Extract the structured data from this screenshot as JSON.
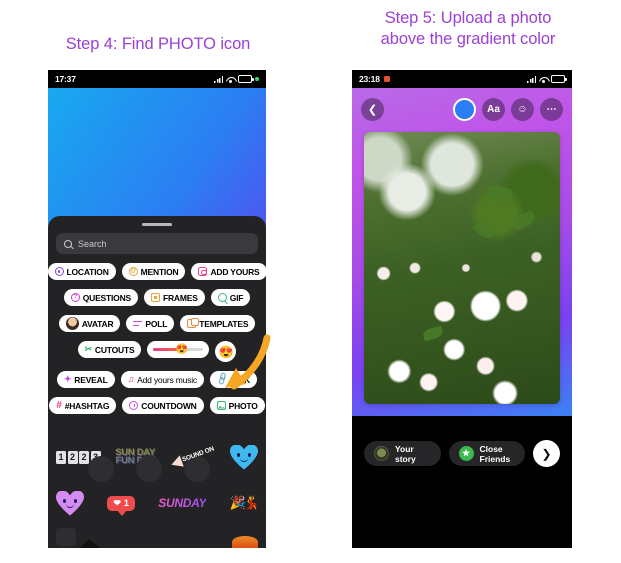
{
  "titles": {
    "left": "Step 4: Find PHOTO icon",
    "right_line1": "Step 5: Upload a photo",
    "right_line2": "above the gradient color"
  },
  "colors": {
    "title_purple": "#9b41d4",
    "arrow_orange": "#f5a623",
    "sheet_dark": "#232325",
    "accent_blue": "#2a7df5",
    "close_friends_green": "#3bb950"
  },
  "left_phone": {
    "status": {
      "time": "17:37",
      "signal": "signal-icon",
      "wifi": "wifi-icon",
      "battery": "60",
      "dot": "green-dot"
    },
    "search": {
      "placeholder": "Search",
      "icon": "search-icon"
    },
    "sticker_rows": [
      [
        {
          "label": "LOCATION",
          "icon": "location-pin-icon"
        },
        {
          "label": "MENTION",
          "icon": "at-mention-icon"
        },
        {
          "label": "ADD YOURS",
          "icon": "camera-icon"
        }
      ],
      [
        {
          "label": "QUESTIONS",
          "icon": "question-bubble-icon"
        },
        {
          "label": "FRAMES",
          "icon": "frame-icon"
        },
        {
          "label": "GIF",
          "icon": "gif-search-icon"
        }
      ],
      [
        {
          "label": "AVATAR",
          "icon": "avatar-icon"
        },
        {
          "label": "POLL",
          "icon": "poll-bars-icon"
        },
        {
          "label": "TEMPLATES",
          "icon": "templates-icon"
        }
      ],
      [
        {
          "label": "CUTOUTS",
          "icon": "scissors-icon"
        },
        {
          "label": "",
          "icon": "emoji-slider-icon"
        },
        {
          "label": "",
          "icon": "heart-eyes-emoji-icon"
        }
      ],
      [
        {
          "label": "REVEAL",
          "icon": "reveal-icon"
        },
        {
          "label": "Add yours music",
          "icon": "music-note-icon"
        },
        {
          "label": "LINK",
          "icon": "link-icon"
        }
      ],
      [
        {
          "label": "#HASHTAG",
          "icon": "hashtag-icon"
        },
        {
          "label": "COUNTDOWN",
          "icon": "countdown-clock-icon"
        },
        {
          "label": "PHOTO",
          "icon": "photo-icon"
        }
      ]
    ],
    "gallery": {
      "counter_digits": [
        "1",
        "2",
        "2",
        "3"
      ],
      "sunday_funday_line1": "SUN DAY",
      "sunday_funday_line2": "FUN DAY",
      "sound_on": "SOUND ON",
      "like_count": "1",
      "sunday": "SUNDAY"
    },
    "annotation": {
      "arrow": "hand-drawn-arrow-pointing-to-photo-icon"
    }
  },
  "right_phone": {
    "status": {
      "time": "23:18",
      "recording": "red-record-dot",
      "signal": "signal-icon",
      "wifi": "wifi-icon",
      "battery": "50"
    },
    "toolbar": {
      "back": "back-chevron-icon",
      "color": "color-picker-icon",
      "text": "Aa",
      "sticker": "sticker-icon",
      "more": "more-options-icon"
    },
    "photo": {
      "description": "white-wild-roses-photo"
    },
    "bottom": {
      "your_story": "Your story",
      "close_friends": "Close Friends",
      "next": "next-arrow-icon"
    }
  }
}
